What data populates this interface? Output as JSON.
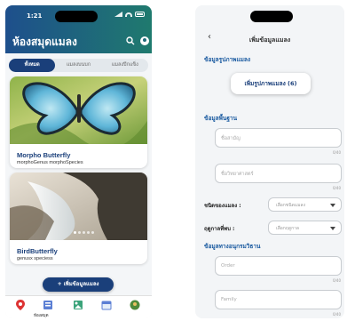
{
  "left": {
    "status_time": "1:21",
    "app_title": "ห้องสมุดแมลง",
    "tabs": [
      {
        "label": "ทั้งหมด",
        "active": true
      },
      {
        "label": "แมลงบนบก",
        "active": false
      },
      {
        "label": "แมลงปีกแข็ง",
        "active": false
      }
    ],
    "cards": [
      {
        "name": "Morpho Butterfly",
        "sub": "morphoGenus morphoSpecies"
      },
      {
        "name": "BirdButterfly",
        "sub": "genusx speciess"
      }
    ],
    "add_button": "+ เพิ่มข้อมูลแมลง",
    "nav": {
      "label_library": "ห้องสมุด"
    }
  },
  "right": {
    "title": "เพิ่มข้อมูลแมลง",
    "section_photo": "ข้อมูลรูปภาพแมลง",
    "photo_button": "เพิ่มรูปภาพแมลง (6)",
    "section_basic": "ข้อมูลพื้นฐาน",
    "field_common_name": "ชื่อสามัญ",
    "field_sci_name": "ชื่อวิทยาศาสตร์",
    "counter": "0/40",
    "label_type": "ชนิดของแมลง :",
    "select_type": "เลือกชนิดแมลง",
    "label_season": "ฤดูกาลที่พบ :",
    "select_season": "เลือกฤดูกาล",
    "section_taxonomy": "ข้อมูลทางอนุกรมวิธาน",
    "field_order": "Order",
    "field_family": "Family"
  },
  "colors": {
    "primary": "#1a3f7a",
    "header_gradient_end": "#1f7a6e",
    "section": "#1a5aa0"
  }
}
